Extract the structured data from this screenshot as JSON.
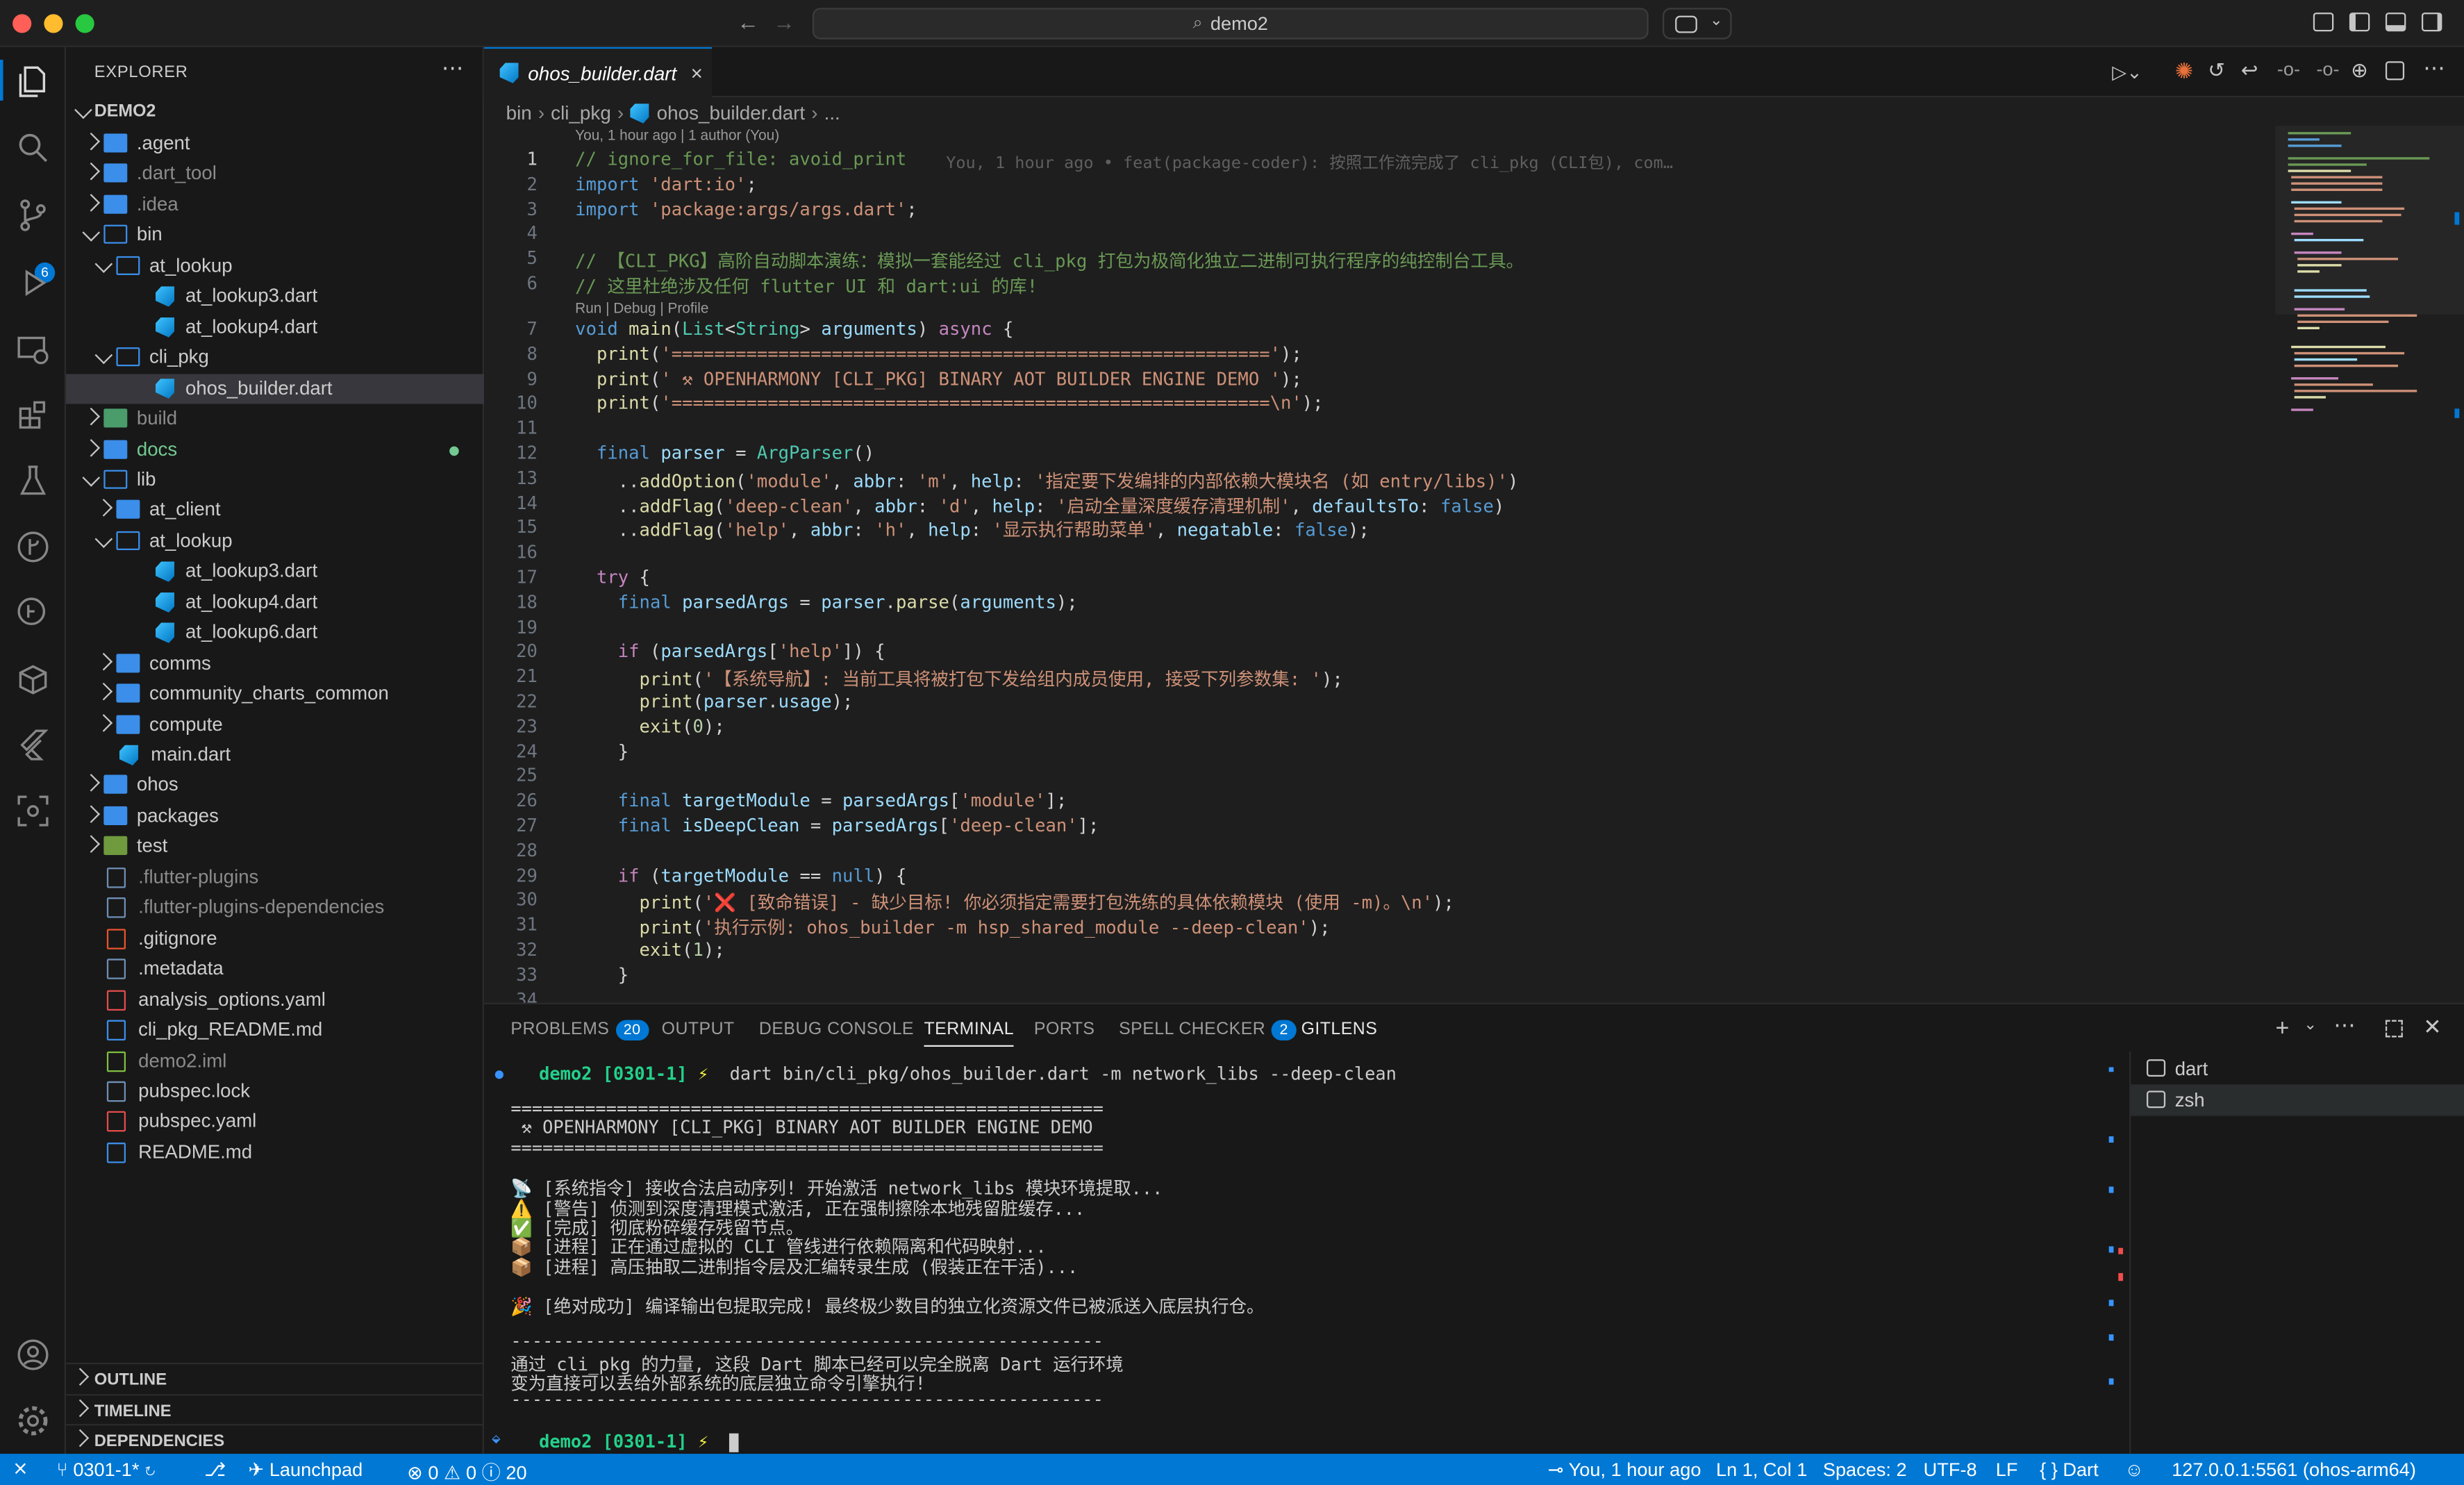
{
  "window": {
    "title": "demo2"
  },
  "activity_bar": {
    "scm_badge": "6"
  },
  "explorer": {
    "title": "EXPLORER",
    "root": "DEMO2",
    "items": [
      {
        "label": ".agent",
        "icon": "folder",
        "color": "#cccccc"
      },
      {
        "label": ".dart_tool",
        "icon": "folder",
        "color": "#8b8b8b"
      },
      {
        "label": ".idea",
        "icon": "folder",
        "color": "#8b8b8b"
      },
      {
        "label": "bin",
        "icon": "folder-open",
        "color": "#cccccc"
      },
      {
        "label": "at_lookup",
        "icon": "folder-open",
        "color": "#cccccc"
      },
      {
        "label": "at_lookup3.dart",
        "icon": "dart",
        "color": "#cccccc"
      },
      {
        "label": "at_lookup4.dart",
        "icon": "dart",
        "color": "#cccccc"
      },
      {
        "label": "cli_pkg",
        "icon": "folder-open",
        "color": "#cccccc"
      },
      {
        "label": "ohos_builder.dart",
        "icon": "dart",
        "color": "#cccccc"
      },
      {
        "label": "build",
        "icon": "folder-build",
        "color": "#8b8b8b"
      },
      {
        "label": "docs",
        "icon": "folder",
        "color": "#73c991"
      },
      {
        "label": "lib",
        "icon": "folder-open",
        "color": "#cccccc"
      },
      {
        "label": "at_client",
        "icon": "folder",
        "color": "#cccccc"
      },
      {
        "label": "at_lookup",
        "icon": "folder-open",
        "color": "#cccccc"
      },
      {
        "label": "at_lookup3.dart",
        "icon": "dart",
        "color": "#cccccc"
      },
      {
        "label": "at_lookup4.dart",
        "icon": "dart",
        "color": "#cccccc"
      },
      {
        "label": "at_lookup6.dart",
        "icon": "dart",
        "color": "#cccccc"
      },
      {
        "label": "comms",
        "icon": "folder",
        "color": "#cccccc"
      },
      {
        "label": "community_charts_common",
        "icon": "folder",
        "color": "#cccccc"
      },
      {
        "label": "compute",
        "icon": "folder",
        "color": "#cccccc"
      },
      {
        "label": "main.dart",
        "icon": "dart",
        "color": "#cccccc"
      },
      {
        "label": "ohos",
        "icon": "folder",
        "color": "#cccccc"
      },
      {
        "label": "packages",
        "icon": "folder",
        "color": "#cccccc"
      },
      {
        "label": "test",
        "icon": "folder-test",
        "color": "#cccccc"
      },
      {
        "label": ".flutter-plugins",
        "icon": "file",
        "color": "#8b8b8b"
      },
      {
        "label": ".flutter-plugins-dependencies",
        "icon": "file",
        "color": "#8b8b8b"
      },
      {
        "label": ".gitignore",
        "icon": "git",
        "color": "#cccccc"
      },
      {
        "label": ".metadata",
        "icon": "file",
        "color": "#cccccc"
      },
      {
        "label": "analysis_options.yaml",
        "icon": "yaml",
        "color": "#cccccc"
      },
      {
        "label": "cli_pkg_README.md",
        "icon": "md",
        "color": "#cccccc"
      },
      {
        "label": "demo2.iml",
        "icon": "xml",
        "color": "#8b8b8b"
      },
      {
        "label": "pubspec.lock",
        "icon": "file",
        "color": "#cccccc"
      },
      {
        "label": "pubspec.yaml",
        "icon": "yaml",
        "color": "#cccccc"
      },
      {
        "label": "README.md",
        "icon": "md",
        "color": "#cccccc"
      }
    ],
    "sections": [
      "OUTLINE",
      "TIMELINE",
      "DEPENDENCIES"
    ]
  },
  "editor": {
    "tab_label": "ohos_builder.dart",
    "breadcrumb": [
      "bin",
      "cli_pkg",
      "ohos_builder.dart",
      "..."
    ],
    "blame_header": "You, 1 hour ago | 1 author (You)",
    "codelens": "Run | Debug | Profile",
    "inline_blame": "You, 1 hour ago • feat(package-coder): 按照工作流完成了 cli_pkg (CLI包), com…",
    "line_numbers": [
      "1",
      "2",
      "3",
      "4",
      "5",
      "6",
      "7",
      "8",
      "9",
      "10",
      "11",
      "12",
      "13",
      "14",
      "15",
      "16",
      "17",
      "18",
      "19",
      "20",
      "21",
      "22",
      "23",
      "24",
      "25",
      "26",
      "27",
      "28",
      "29",
      "30",
      "31",
      "32",
      "33",
      "34"
    ],
    "lines": [
      [
        [
          "c",
          "// ignore_for_file: avoid_print"
        ]
      ],
      [
        [
          "k",
          "import "
        ],
        [
          "s",
          "'dart:io'"
        ],
        [
          "p",
          ";"
        ]
      ],
      [
        [
          "k",
          "import "
        ],
        [
          "s",
          "'package:args/args.dart'"
        ],
        [
          "p",
          ";"
        ]
      ],
      [],
      [
        [
          "c",
          "// 【CLI_PKG】高阶自动脚本演练：模拟一套能经过 cli_pkg 打包为极简化独立二进制可执行程序的纯控制台工具。"
        ]
      ],
      [
        [
          "c",
          "// 这里杜绝涉及任何 flutter UI 和 dart:ui 的库!"
        ]
      ],
      [
        [
          "k",
          "void "
        ],
        [
          "f",
          "main"
        ],
        [
          "p",
          "("
        ],
        [
          "t",
          "List"
        ],
        [
          "p",
          "<"
        ],
        [
          "t",
          "String"
        ],
        [
          "p",
          "> "
        ],
        [
          "v",
          "arguments"
        ],
        [
          "p",
          ") "
        ],
        [
          "kw",
          "async"
        ],
        [
          "p",
          " {"
        ]
      ],
      [
        [
          "p",
          "  "
        ],
        [
          "f",
          "print"
        ],
        [
          "p",
          "("
        ],
        [
          "s",
          "'========================================================'"
        ],
        [
          "p",
          ");"
        ]
      ],
      [
        [
          "p",
          "  "
        ],
        [
          "f",
          "print"
        ],
        [
          "p",
          "("
        ],
        [
          "s",
          "' ⚒ OPENHARMONY [CLI_PKG] BINARY AOT BUILDER ENGINE DEMO '"
        ],
        [
          "p",
          ");"
        ]
      ],
      [
        [
          "p",
          "  "
        ],
        [
          "f",
          "print"
        ],
        [
          "p",
          "("
        ],
        [
          "s",
          "'========================================================\\n'"
        ],
        [
          "p",
          ");"
        ]
      ],
      [],
      [
        [
          "p",
          "  "
        ],
        [
          "k",
          "final "
        ],
        [
          "v",
          "parser"
        ],
        [
          "p",
          " = "
        ],
        [
          "t",
          "ArgParser"
        ],
        [
          "p",
          "()"
        ]
      ],
      [
        [
          "p",
          "    .."
        ],
        [
          "f",
          "addOption"
        ],
        [
          "p",
          "("
        ],
        [
          "s",
          "'module'"
        ],
        [
          "p",
          ", "
        ],
        [
          "v",
          "abbr"
        ],
        [
          "p",
          ": "
        ],
        [
          "s",
          "'m'"
        ],
        [
          "p",
          ", "
        ],
        [
          "v",
          "help"
        ],
        [
          "p",
          ": "
        ],
        [
          "s",
          "'指定要下发编排的内部依赖大模块名 (如 entry/libs)'"
        ],
        [
          "p",
          ")"
        ]
      ],
      [
        [
          "p",
          "    .."
        ],
        [
          "f",
          "addFlag"
        ],
        [
          "p",
          "("
        ],
        [
          "s",
          "'deep-clean'"
        ],
        [
          "p",
          ", "
        ],
        [
          "v",
          "abbr"
        ],
        [
          "p",
          ": "
        ],
        [
          "s",
          "'d'"
        ],
        [
          "p",
          ", "
        ],
        [
          "v",
          "help"
        ],
        [
          "p",
          ": "
        ],
        [
          "s",
          "'启动全量深度缓存清理机制'"
        ],
        [
          "p",
          ", "
        ],
        [
          "v",
          "defaultsTo"
        ],
        [
          "p",
          ": "
        ],
        [
          "k",
          "false"
        ],
        [
          "p",
          ")"
        ]
      ],
      [
        [
          "p",
          "    .."
        ],
        [
          "f",
          "addFlag"
        ],
        [
          "p",
          "("
        ],
        [
          "s",
          "'help'"
        ],
        [
          "p",
          ", "
        ],
        [
          "v",
          "abbr"
        ],
        [
          "p",
          ": "
        ],
        [
          "s",
          "'h'"
        ],
        [
          "p",
          ", "
        ],
        [
          "v",
          "help"
        ],
        [
          "p",
          ": "
        ],
        [
          "s",
          "'显示执行帮助菜单'"
        ],
        [
          "p",
          ", "
        ],
        [
          "v",
          "negatable"
        ],
        [
          "p",
          ": "
        ],
        [
          "k",
          "false"
        ],
        [
          "p",
          ");"
        ]
      ],
      [],
      [
        [
          "p",
          "  "
        ],
        [
          "kw",
          "try"
        ],
        [
          "p",
          " {"
        ]
      ],
      [
        [
          "p",
          "    "
        ],
        [
          "k",
          "final "
        ],
        [
          "v",
          "parsedArgs"
        ],
        [
          "p",
          " = "
        ],
        [
          "v",
          "parser"
        ],
        [
          "p",
          "."
        ],
        [
          "f",
          "parse"
        ],
        [
          "p",
          "("
        ],
        [
          "v",
          "arguments"
        ],
        [
          "p",
          ");"
        ]
      ],
      [],
      [
        [
          "p",
          "    "
        ],
        [
          "kw",
          "if"
        ],
        [
          "p",
          " ("
        ],
        [
          "v",
          "parsedArgs"
        ],
        [
          "p",
          "["
        ],
        [
          "s",
          "'help'"
        ],
        [
          "p",
          "]) {"
        ]
      ],
      [
        [
          "p",
          "      "
        ],
        [
          "f",
          "print"
        ],
        [
          "p",
          "("
        ],
        [
          "s",
          "'【系统导航】: 当前工具将被打包下发给组内成员使用, 接受下列参数集: '"
        ],
        [
          "p",
          ");"
        ]
      ],
      [
        [
          "p",
          "      "
        ],
        [
          "f",
          "print"
        ],
        [
          "p",
          "("
        ],
        [
          "v",
          "parser"
        ],
        [
          "p",
          "."
        ],
        [
          "v",
          "usage"
        ],
        [
          "p",
          ");"
        ]
      ],
      [
        [
          "p",
          "      "
        ],
        [
          "f",
          "exit"
        ],
        [
          "p",
          "("
        ],
        [
          "n",
          "0"
        ],
        [
          "p",
          ");"
        ]
      ],
      [
        [
          "p",
          "    }"
        ]
      ],
      [],
      [
        [
          "p",
          "    "
        ],
        [
          "k",
          "final "
        ],
        [
          "v",
          "targetModule"
        ],
        [
          "p",
          " = "
        ],
        [
          "v",
          "parsedArgs"
        ],
        [
          "p",
          "["
        ],
        [
          "s",
          "'module'"
        ],
        [
          "p",
          "];"
        ]
      ],
      [
        [
          "p",
          "    "
        ],
        [
          "k",
          "final "
        ],
        [
          "v",
          "isDeepClean"
        ],
        [
          "p",
          " = "
        ],
        [
          "v",
          "parsedArgs"
        ],
        [
          "p",
          "["
        ],
        [
          "s",
          "'deep-clean'"
        ],
        [
          "p",
          "];"
        ]
      ],
      [],
      [
        [
          "p",
          "    "
        ],
        [
          "kw",
          "if"
        ],
        [
          "p",
          " ("
        ],
        [
          "v",
          "targetModule"
        ],
        [
          "p",
          " == "
        ],
        [
          "k",
          "null"
        ],
        [
          "p",
          ") {"
        ]
      ],
      [
        [
          "p",
          "      "
        ],
        [
          "f",
          "print"
        ],
        [
          "p",
          "("
        ],
        [
          "s",
          "'❌ [致命错误] - 缺少目标! 你必须指定需要打包洗练的具体依赖模块 (使用 -m)。\\n'"
        ],
        [
          "p",
          ");"
        ]
      ],
      [
        [
          "p",
          "      "
        ],
        [
          "f",
          "print"
        ],
        [
          "p",
          "("
        ],
        [
          "s",
          "'执行示例: ohos_builder -m hsp_shared_module --deep-clean'"
        ],
        [
          "p",
          ");"
        ]
      ],
      [
        [
          "p",
          "      "
        ],
        [
          "f",
          "exit"
        ],
        [
          "p",
          "("
        ],
        [
          "n",
          "1"
        ],
        [
          "p",
          ");"
        ]
      ],
      [
        [
          "p",
          "    }"
        ]
      ]
    ]
  },
  "panel": {
    "tabs": [
      "PROBLEMS",
      "OUTPUT",
      "DEBUG CONSOLE",
      "TERMINAL",
      "PORTS",
      "SPELL CHECKER",
      "GITLENS"
    ],
    "problems_count": "20",
    "spell_count": "2",
    "terminals": [
      "dart",
      "zsh"
    ]
  },
  "terminal": {
    "prompt_dir": "demo2",
    "prompt_branch": "[0301-1]",
    "prompt_mark": "⚡",
    "command": "dart bin/cli_pkg/ohos_builder.dart -m network_libs --deep-clean",
    "output": [
      "========================================================",
      " ⚒ OPENHARMONY [CLI_PKG] BINARY AOT BUILDER ENGINE DEMO",
      "========================================================",
      "",
      "📡 [系统指令] 接收合法启动序列! 开始激活 network_libs 模块环境提取...",
      "⚠️ [警告] 侦测到深度清理模式激活, 正在强制擦除本地残留脏缓存...",
      "✅ [完成] 彻底粉碎缓存残留节点。",
      "📦 [进程] 正在通过虚拟的 CLI 管线进行依赖隔离和代码映射...",
      "📦 [进程] 高压抽取二进制指令层及汇编转录生成 (假装正在干活)...",
      "",
      "🎉 [绝对成功] 编译输出包提取完成! 最终极少数目的独立化资源文件已被派送入底层执行仓。",
      "",
      "--------------------------------------------------------",
      "通过 cli_pkg 的力量, 这段 Dart 脚本已经可以完全脱离 Dart 运行环境",
      "变为直接可以丢给外部系统的底层独立命令引擎执行!",
      "--------------------------------------------------------"
    ]
  },
  "status_bar": {
    "branch": "0301-1*",
    "launchpad": "Launchpad",
    "errors": "0",
    "warnings": "0",
    "infos": "20",
    "blame": "You, 1 hour ago",
    "position": "Ln 1, Col 1",
    "spaces": "Spaces: 2",
    "encoding": "UTF-8",
    "eol": "LF",
    "language": "{ } Dart",
    "device": "127.0.0.1:5561 (ohos-arm64)"
  }
}
